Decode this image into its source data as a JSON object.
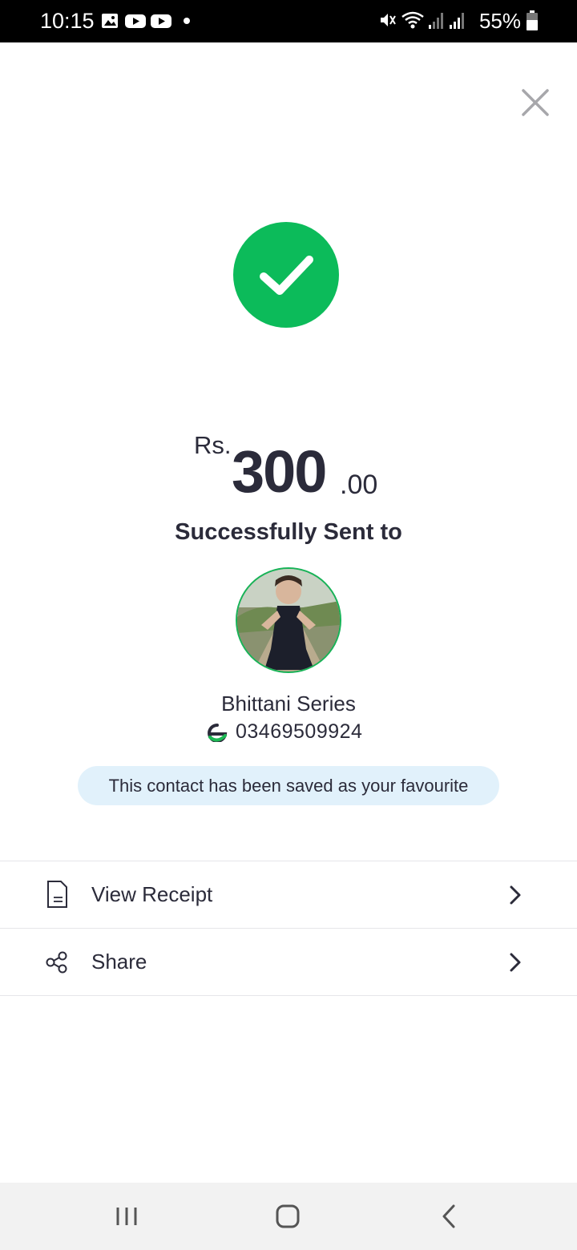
{
  "status_bar": {
    "time": "10:15",
    "battery": "55%",
    "icons": [
      "gallery-icon",
      "youtube-icon",
      "youtube-icon",
      "notification-dot",
      "mute-icon",
      "wifi-icon",
      "signal-icon",
      "signal-icon",
      "battery-icon"
    ]
  },
  "close_icon": "close-icon",
  "success_icon": "check-icon",
  "amount": {
    "currency": "Rs.",
    "whole": "300",
    "decimal": ".00"
  },
  "sent_label": "Successfully Sent to",
  "contact": {
    "name": "Bhittani Series",
    "number": "03469509924",
    "wallet_icon": "easypaisa-icon"
  },
  "favourite_notice": "This contact has been saved as your favourite",
  "actions": [
    {
      "label": "View Receipt",
      "icon": "receipt-icon"
    },
    {
      "label": "Share",
      "icon": "share-icon"
    }
  ],
  "colors": {
    "success": "#0cbb5a",
    "text": "#2b2b3a",
    "banner_bg": "#e1f1fb"
  },
  "nav": [
    "recents-icon",
    "home-icon",
    "back-icon"
  ]
}
